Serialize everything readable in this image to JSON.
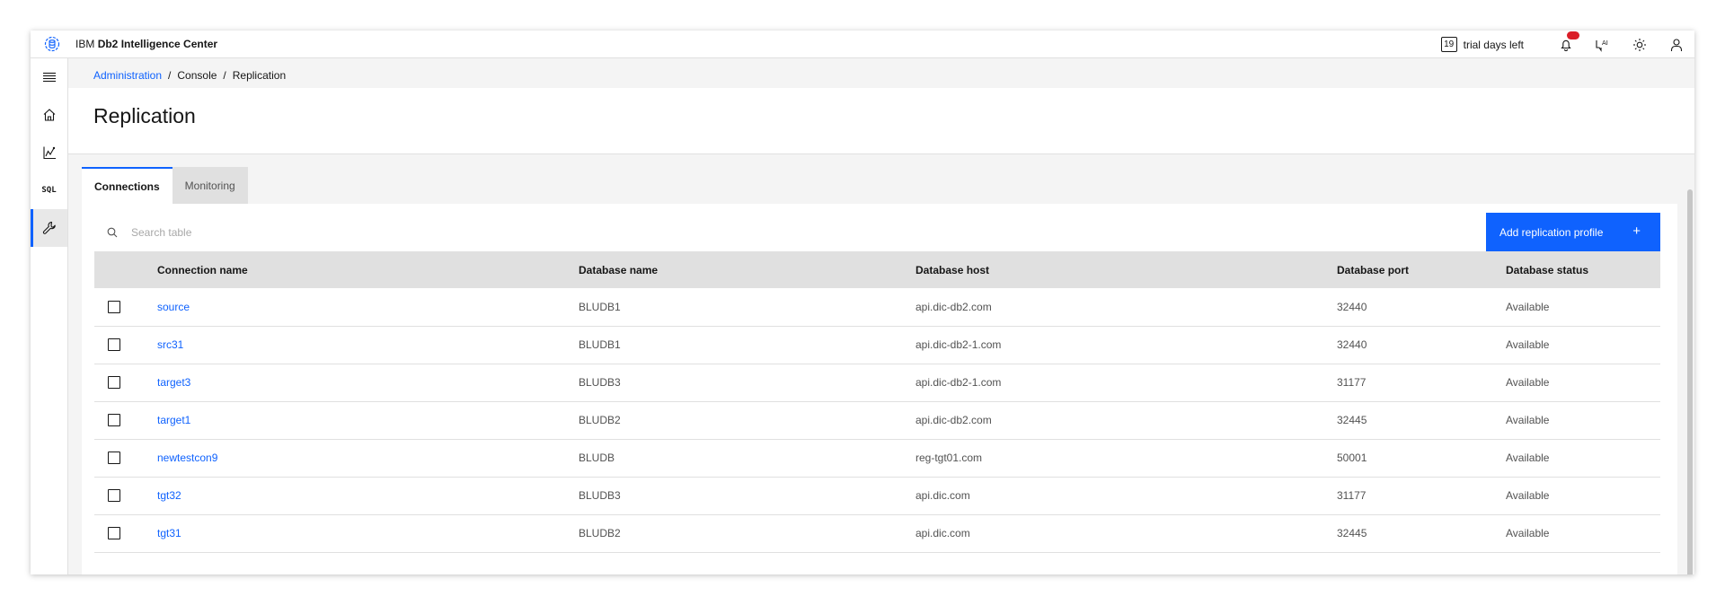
{
  "header": {
    "brand_prefix": "IBM",
    "brand_name": "Db2 Intelligence Center",
    "trial_days": "19",
    "trial_label": "trial days left",
    "icons": [
      "logo-icon",
      "notification-icon",
      "ai-assistant-icon",
      "theme-toggle-icon",
      "user-icon"
    ]
  },
  "sidenav": {
    "items": [
      {
        "name": "menu",
        "icon": "hamburger-menu-icon"
      },
      {
        "name": "home",
        "icon": "home-icon"
      },
      {
        "name": "monitor",
        "icon": "chart-icon"
      },
      {
        "name": "sql",
        "label": "SQL"
      },
      {
        "name": "administration",
        "icon": "wrench-icon",
        "active": true
      }
    ]
  },
  "breadcrumb": {
    "items": [
      "Administration",
      "Console",
      "Replication"
    ],
    "separator": "/"
  },
  "page": {
    "title": "Replication"
  },
  "tabs": [
    {
      "label": "Connections",
      "active": true
    },
    {
      "label": "Monitoring",
      "active": false
    }
  ],
  "toolbar": {
    "search_placeholder": "Search table",
    "add_button_label": "Add replication profile",
    "add_button_icon": "+"
  },
  "table": {
    "columns": [
      "Connection name",
      "Database name",
      "Database host",
      "Database port",
      "Database status"
    ],
    "rows": [
      {
        "name": "source",
        "db": "BLUDB1",
        "host": "api.dic-db2.com",
        "port": "32440",
        "status": "Available"
      },
      {
        "name": "src31",
        "db": "BLUDB1",
        "host": "api.dic-db2-1.com",
        "port": "32440",
        "status": "Available"
      },
      {
        "name": "target3",
        "db": "BLUDB3",
        "host": "api.dic-db2-1.com",
        "port": "31177",
        "status": "Available"
      },
      {
        "name": "target1",
        "db": "BLUDB2",
        "host": "api.dic-db2.com",
        "port": "32445",
        "status": "Available"
      },
      {
        "name": "newtestcon9",
        "db": "BLUDB",
        "host": "reg-tgt01.com",
        "port": "50001",
        "status": "Available"
      },
      {
        "name": "tgt32",
        "db": "BLUDB3",
        "host": "api.dic.com",
        "port": "31177",
        "status": "Available"
      },
      {
        "name": "tgt31",
        "db": "BLUDB2",
        "host": "api.dic.com",
        "port": "32445",
        "status": "Available"
      }
    ]
  },
  "colors": {
    "accent": "#0f62fe",
    "notification": "#da1e28",
    "header_row": "#e0e0e0",
    "background": "#f4f4f4"
  }
}
